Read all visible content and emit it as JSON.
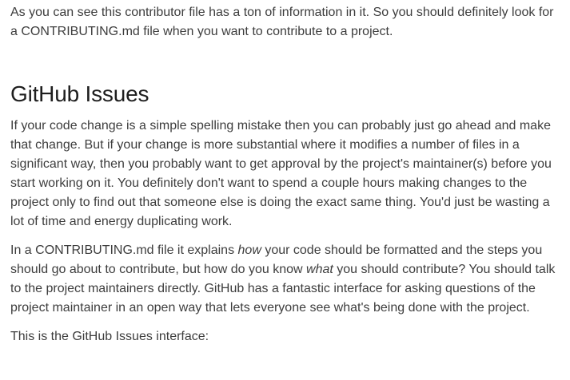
{
  "article": {
    "intro": "As you can see this contributor file has a ton of information in it. So you should definitely look for a CONTRIBUTING.md file when you want to contribute to a project.",
    "heading": "GitHub Issues",
    "paragraph1": "If your code change is a simple spelling mistake then you can probably just go ahead and make that change. But if your change is more substantial where it modifies a number of files in a significant way, then you probably want to get approval by the project's maintainer(s) before you start working on it. You definitely don't want to spend a couple hours making changes to the project only to find out that someone else is doing the exact same thing. You'd just be wasting a lot of time and energy duplicating work.",
    "paragraph2": {
      "part1": "In a CONTRIBUTING.md file it explains ",
      "em1": "how",
      "part2": " your code should be formatted and the steps you should go about to contribute, but how do you know ",
      "em2": "what",
      "part3": " you should contribute? You should talk to the project maintainers directly. GitHub has a fantastic interface for asking questions of the project maintainer in an open way that lets everyone see what's being done with the project."
    },
    "paragraph3": "This is the GitHub Issues interface:"
  }
}
